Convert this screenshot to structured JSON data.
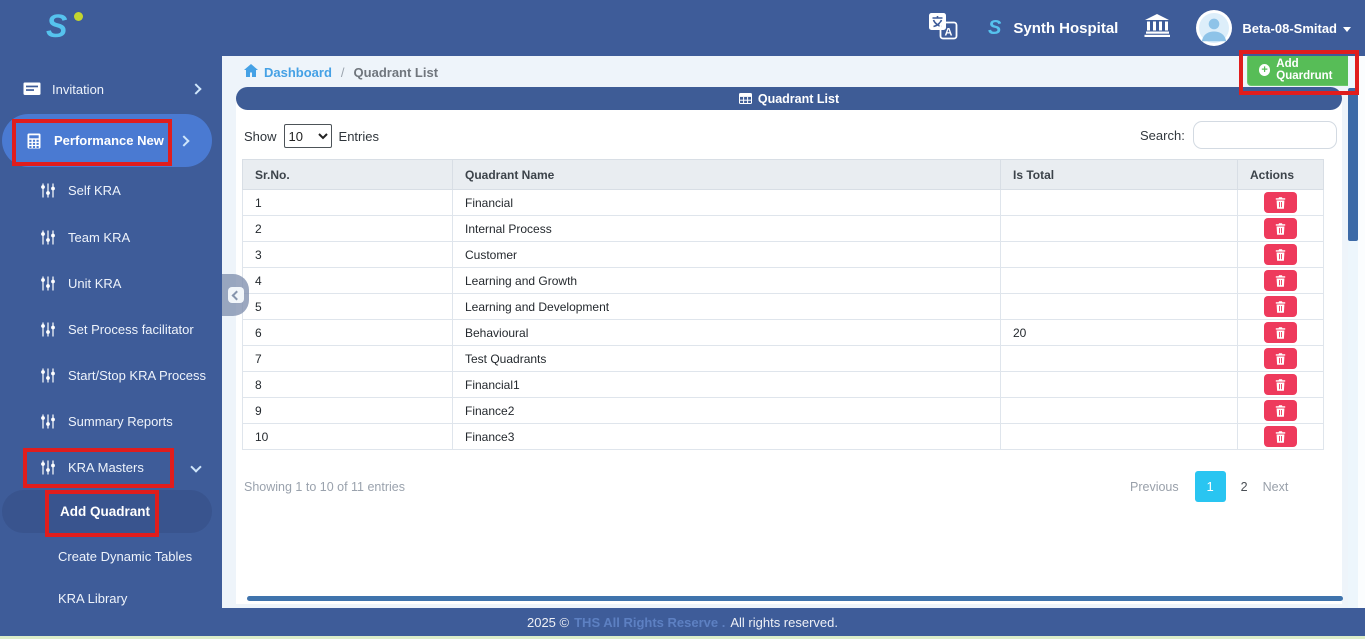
{
  "header": {
    "logo_letter": "S",
    "hospital_name": "Synth Hospital",
    "user_name": "Beta-08-Smitad"
  },
  "sidebar": {
    "invitation": "Invitation",
    "performance_new": "Performance New",
    "items": [
      "Self KRA",
      "Team KRA",
      "Unit KRA",
      "Set Process facilitator",
      "Start/Stop KRA Process",
      "Summary Reports"
    ],
    "kra_masters": "KRA Masters",
    "kra_children": [
      "Add Quadrant",
      "Create Dynamic Tables",
      "KRA Library"
    ]
  },
  "breadcrumb": {
    "dashboard": "Dashboard",
    "separator": "/",
    "current": "Quadrant List"
  },
  "toolbar": {
    "add_button": "Add Quardrunt"
  },
  "panel": {
    "title": "Quadrant List"
  },
  "table_controls": {
    "show": "Show",
    "page_size": "10",
    "entries": "Entries",
    "search_label": "Search:",
    "search_value": ""
  },
  "table": {
    "headers": [
      "Sr.No.",
      "Quadrant Name",
      "Is Total",
      "Actions"
    ],
    "rows": [
      {
        "sr": "1",
        "name": "Financial",
        "is_total": ""
      },
      {
        "sr": "2",
        "name": "Internal Process",
        "is_total": ""
      },
      {
        "sr": "3",
        "name": "Customer",
        "is_total": ""
      },
      {
        "sr": "4",
        "name": "Learning and Growth",
        "is_total": ""
      },
      {
        "sr": "5",
        "name": "Learning and Development",
        "is_total": ""
      },
      {
        "sr": "6",
        "name": "Behavioural",
        "is_total": "20"
      },
      {
        "sr": "7",
        "name": "Test Quadrants",
        "is_total": ""
      },
      {
        "sr": "8",
        "name": "Financial1",
        "is_total": ""
      },
      {
        "sr": "9",
        "name": "Finance2",
        "is_total": ""
      },
      {
        "sr": "10",
        "name": "Finance3",
        "is_total": ""
      }
    ]
  },
  "pagination": {
    "info": "Showing 1 to 10 of 11 entries",
    "previous": "Previous",
    "page1": "1",
    "page2": "2",
    "next": "Next"
  },
  "footer": {
    "year": "2025 ©",
    "link": "THS All Rights Reserve .",
    "rights": "All rights reserved."
  },
  "icons": {
    "plus": "+"
  },
  "colors": {
    "header_blue": "#3e5c99",
    "active_pill_blue": "#4a7ad2",
    "panel_blue": "#3e5c96",
    "button_green": "#57bd57",
    "delete_pink": "#ee3a5c",
    "page_active_cyan": "#29c5f1",
    "annotation_red": "#e01d1d"
  }
}
